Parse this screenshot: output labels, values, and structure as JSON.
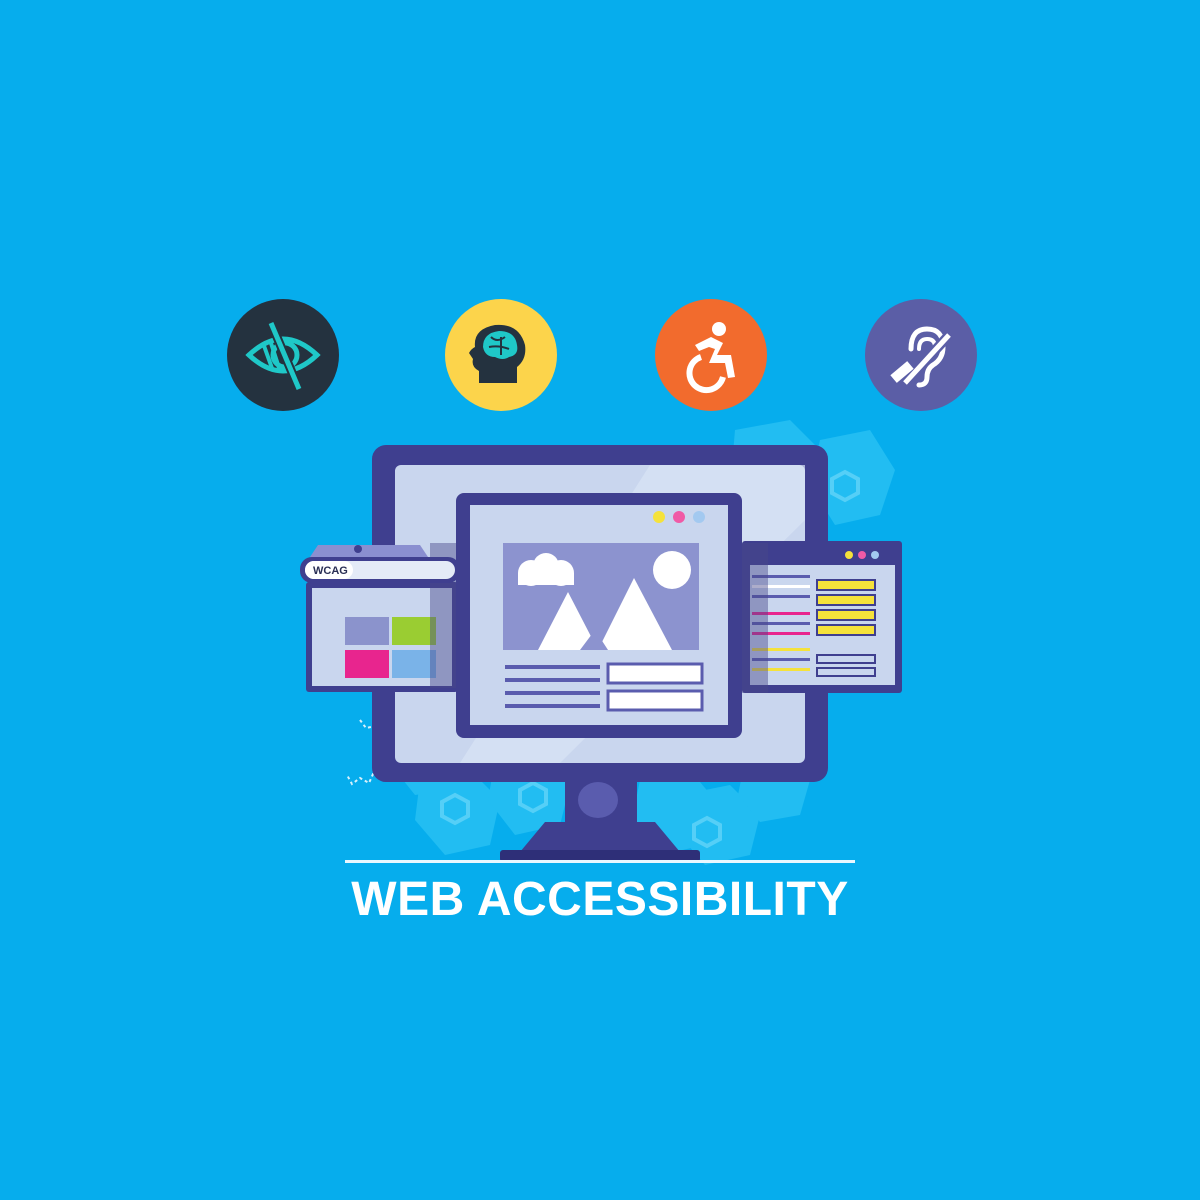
{
  "title": "WEB ACCESSIBILITY",
  "browser_tag": "WCAG",
  "icons": {
    "vision": "visual-impairment-icon",
    "cognitive": "cognitive-brain-icon",
    "mobility": "wheelchair-icon",
    "hearing": "hearing-impairment-icon"
  },
  "colors": {
    "background": "#06aded",
    "vision_badge": "#24323f",
    "cognitive_badge": "#fcd44b",
    "mobility_badge": "#f26b2d",
    "hearing_badge": "#5b5ea6",
    "monitor_frame": "#3f3f8f",
    "screen": "#c9d6ee"
  }
}
